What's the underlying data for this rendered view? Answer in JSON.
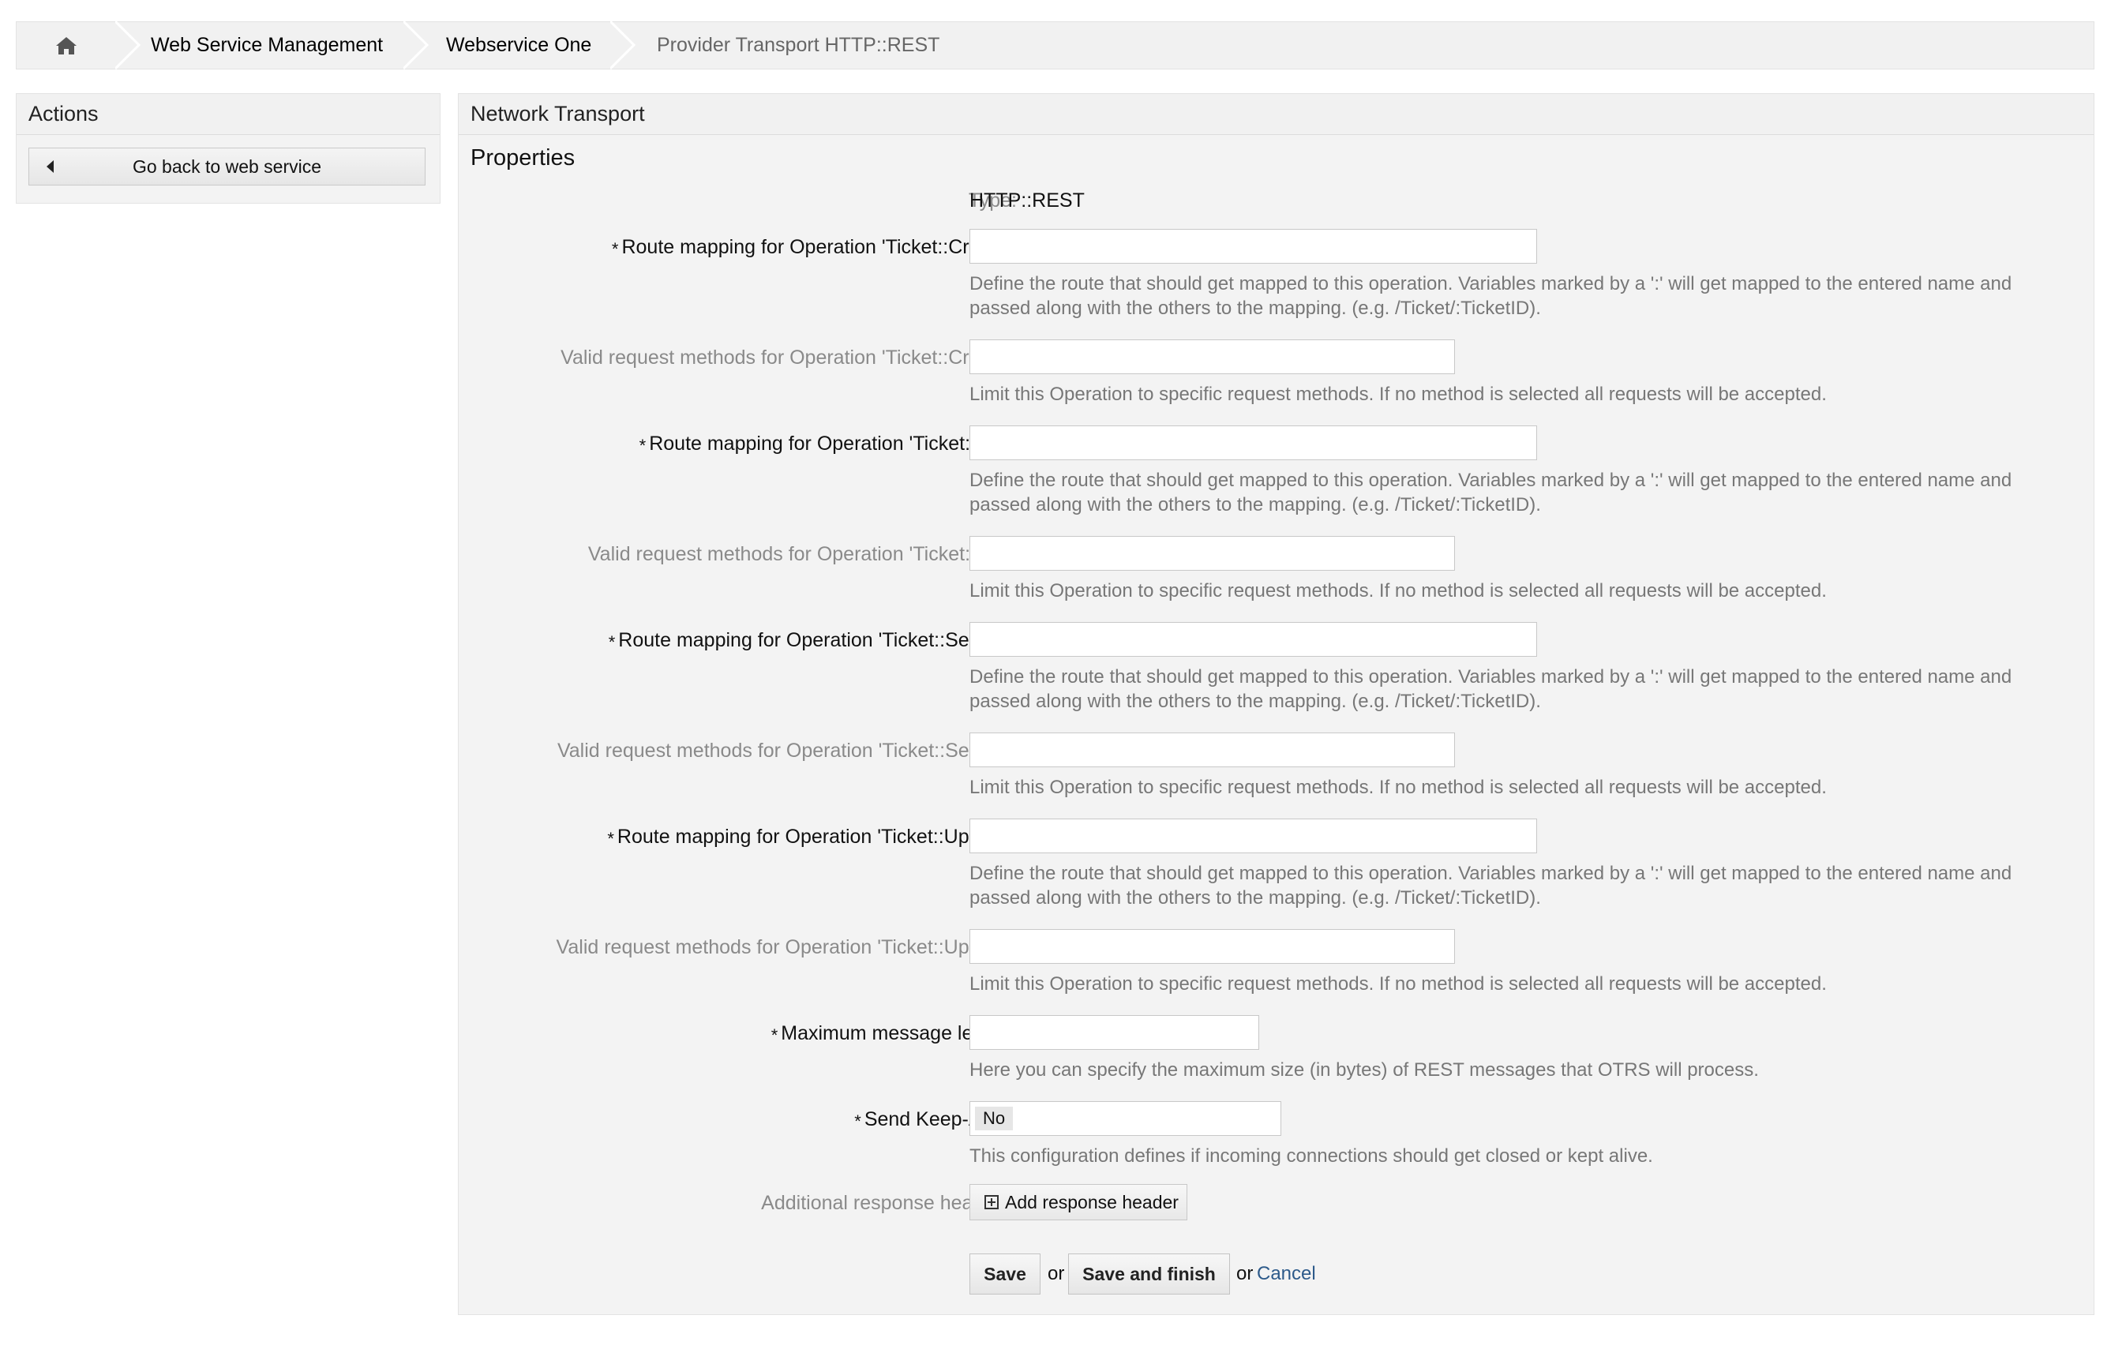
{
  "breadcrumb": {
    "home_icon": "home-icon",
    "items": [
      "Web Service Management",
      "Webservice One"
    ],
    "current": "Provider Transport HTTP::REST"
  },
  "sidebar": {
    "title": "Actions",
    "back_button": "Go back to web service"
  },
  "main": {
    "title": "Network Transport",
    "section": "Properties",
    "type_label": "Type:",
    "type_value": "HTTP::REST",
    "rows": [
      {
        "label": "Route mapping for Operation 'Ticket::Create':",
        "help": "Define the route that should get mapped to this operation. Variables marked by a ':' will get mapped to the entered name and passed along with the others to the mapping. (e.g. /Ticket/:TicketID).",
        "value": ""
      },
      {
        "label": "Valid request methods for Operation 'Ticket::Create':",
        "help": "Limit this Operation to specific request methods. If no method is selected all requests will be accepted.",
        "value": ""
      },
      {
        "label": "Route mapping for Operation 'Ticket::Get':",
        "help": "Define the route that should get mapped to this operation. Variables marked by a ':' will get mapped to the entered name and passed along with the others to the mapping. (e.g. /Ticket/:TicketID).",
        "value": ""
      },
      {
        "label": "Valid request methods for Operation 'Ticket::Get':",
        "help": "Limit this Operation to specific request methods. If no method is selected all requests will be accepted.",
        "value": ""
      },
      {
        "label": "Route mapping for Operation 'Ticket::Search':",
        "help": "Define the route that should get mapped to this operation. Variables marked by a ':' will get mapped to the entered name and passed along with the others to the mapping. (e.g. /Ticket/:TicketID).",
        "value": ""
      },
      {
        "label": "Valid request methods for Operation 'Ticket::Search':",
        "help": "Limit this Operation to specific request methods. If no method is selected all requests will be accepted.",
        "value": ""
      },
      {
        "label": "Route mapping for Operation 'Ticket::Update':",
        "help": "Define the route that should get mapped to this operation. Variables marked by a ':' will get mapped to the entered name and passed along with the others to the mapping. (e.g. /Ticket/:TicketID).",
        "value": ""
      },
      {
        "label": "Valid request methods for Operation 'Ticket::Update':",
        "help": "Limit this Operation to specific request methods. If no method is selected all requests will be accepted.",
        "value": ""
      }
    ],
    "max_length": {
      "label": "Maximum message length:",
      "help": "Here you can specify the maximum size (in bytes) of REST messages that OTRS will process.",
      "value": ""
    },
    "keep_alive": {
      "label": "Send Keep-Alive:",
      "help": "This configuration defines if incoming connections should get closed or kept alive.",
      "value": "No"
    },
    "headers": {
      "label": "Additional response headers:",
      "button": "Add response header"
    },
    "required_marker": "*",
    "actions": {
      "save": "Save",
      "or1": "or",
      "save_finish": "Save and finish",
      "or2": "or",
      "cancel": "Cancel"
    }
  }
}
